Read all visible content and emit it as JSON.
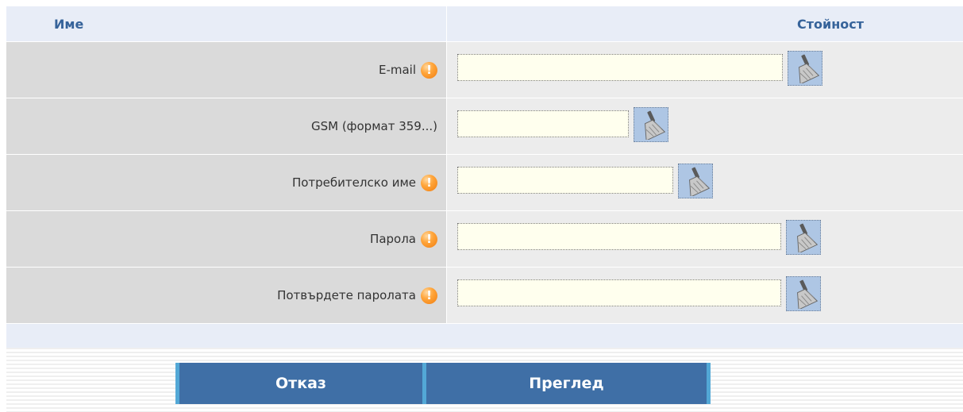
{
  "header": {
    "name_col": "Име",
    "value_col": "Стойност"
  },
  "fields": [
    {
      "label": "E-mail",
      "required": true,
      "value": ""
    },
    {
      "label": "GSM (формат 359...)",
      "required": false,
      "value": ""
    },
    {
      "label": "Потребителско име",
      "required": true,
      "value": ""
    },
    {
      "label": "Парола",
      "required": true,
      "value": ""
    },
    {
      "label": "Потвърдете паролата",
      "required": true,
      "value": ""
    }
  ],
  "icons": {
    "required": "exclamation-icon",
    "clear": "broom-icon"
  },
  "buttons": {
    "cancel": "Отказ",
    "preview": "Преглед"
  },
  "colors": {
    "header_bg": "#e8edf7",
    "header_text": "#36639a",
    "label_bg": "#dadada",
    "value_bg": "#ececec",
    "input_bg": "#ffffee",
    "button_bg": "#3f6fa6",
    "button_edge": "#53a8d6",
    "warning": "#f7941d"
  }
}
